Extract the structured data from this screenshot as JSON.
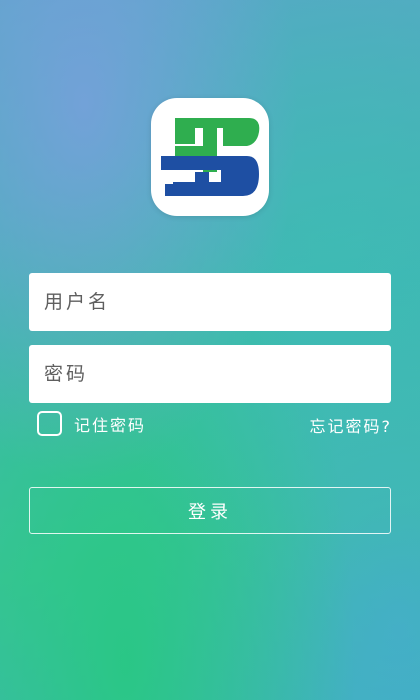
{
  "logo": {
    "icon": "app-logo-icon",
    "colors": {
      "green": "#2fae4f",
      "blue": "#1e4fa3"
    }
  },
  "form": {
    "username_placeholder": "用户名",
    "password_placeholder": "密码",
    "remember_label": "记住密码",
    "remember_checked": false,
    "forgot_label": "忘记密码?",
    "login_label": "登录"
  }
}
